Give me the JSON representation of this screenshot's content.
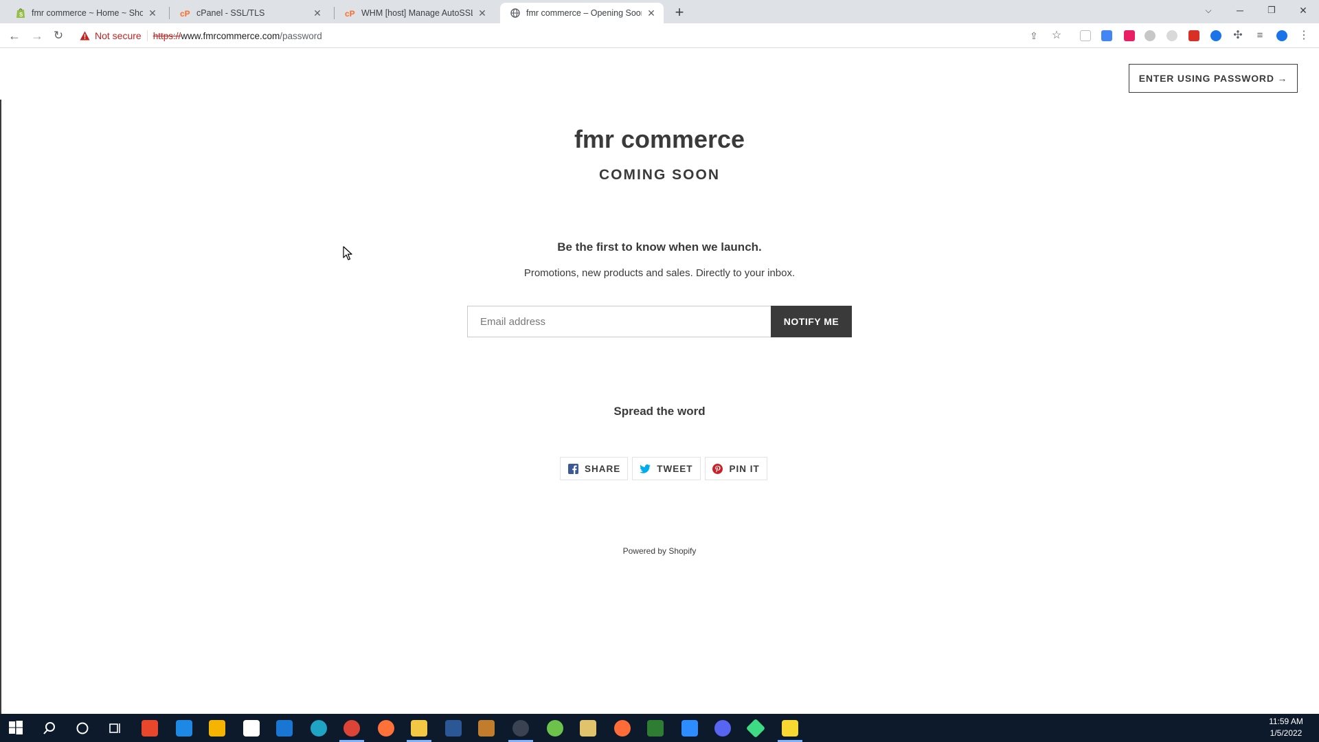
{
  "browser": {
    "tabs": [
      {
        "title": "fmr commerce ~ Home ~ Shopify",
        "icon": "shopify-icon"
      },
      {
        "title": "cPanel - SSL/TLS",
        "icon": "cpanel-icon"
      },
      {
        "title": "WHM [host] Manage AutoSSL - E",
        "icon": "cpanel-icon"
      },
      {
        "title": "fmr commerce – Opening Soon",
        "icon": "globe-icon",
        "active": true
      }
    ],
    "security_label": "Not secure",
    "url_scheme": "https://",
    "url_host": "www.fmrcommerce.com",
    "url_path": "/password"
  },
  "page": {
    "enter_password_label": "ENTER USING PASSWORD →",
    "store_name": "fmr commerce",
    "coming_soon": "COMING SOON",
    "launch_heading": "Be the first to know when we launch.",
    "promo_text": "Promotions, new products and sales. Directly to your inbox.",
    "email_placeholder": "Email address",
    "notify_label": "NOTIFY ME",
    "spread_heading": "Spread the word",
    "share": [
      {
        "label": "SHARE",
        "icon": "facebook-icon",
        "color": "#3b5998"
      },
      {
        "label": "TWEET",
        "icon": "twitter-icon",
        "color": "#00aced"
      },
      {
        "label": "PIN IT",
        "icon": "pinterest-icon",
        "color": "#cb2027"
      }
    ],
    "powered_by": "Powered by Shopify"
  },
  "taskbar": {
    "time": "11:59 AM",
    "date": "1/5/2022"
  },
  "colors": {
    "accent_dark": "#3a3a3a",
    "not_secure_red": "#c5221f",
    "tabstrip": "#dee1e6",
    "taskbar": "#0d1a2b"
  }
}
